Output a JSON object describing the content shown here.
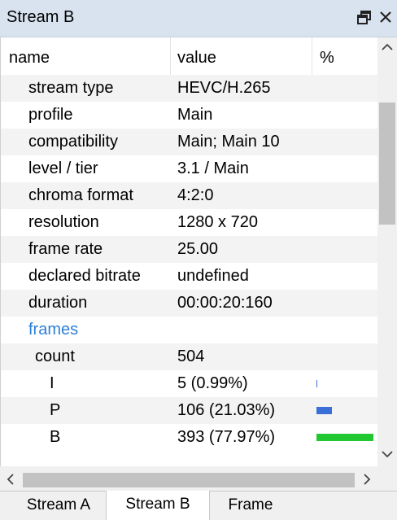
{
  "panel": {
    "title": "Stream B"
  },
  "table": {
    "headers": {
      "name": "name",
      "value": "value",
      "percent": "%"
    },
    "rows": [
      {
        "name": "stream type",
        "value": "HEVC/H.265",
        "level": 1
      },
      {
        "name": "profile",
        "value": "Main",
        "level": 1
      },
      {
        "name": "compatibility",
        "value": "Main; Main 10",
        "level": 1
      },
      {
        "name": "level / tier",
        "value": "3.1 / Main",
        "level": 1
      },
      {
        "name": "chroma format",
        "value": "4:2:0",
        "level": 1
      },
      {
        "name": "resolution",
        "value": "1280 x 720",
        "level": 1
      },
      {
        "name": "frame rate",
        "value": "25.00",
        "level": 1
      },
      {
        "name": "declared bitrate",
        "value": "undefined",
        "level": 1
      },
      {
        "name": "duration",
        "value": "00:00:20:160",
        "level": 1
      },
      {
        "name": "frames",
        "value": "",
        "level": 1,
        "link": true
      },
      {
        "name": "count",
        "value": "504",
        "level": 2
      },
      {
        "name": "I",
        "value": "5 (0.99%)",
        "level": 3,
        "bar_fraction": 0.0099,
        "bar_color": "#3a6fd8"
      },
      {
        "name": "P",
        "value": "106 (21.03%)",
        "level": 3,
        "bar_fraction": 0.2103,
        "bar_color": "#3a6fd8"
      },
      {
        "name": "B",
        "value": "393 (77.97%)",
        "level": 3,
        "bar_fraction": 0.7797,
        "bar_color": "#22c832"
      }
    ]
  },
  "tabs": [
    {
      "label": "Stream A",
      "active": false
    },
    {
      "label": "Stream B",
      "active": true
    },
    {
      "label": "Frame",
      "active": false
    }
  ],
  "colors": {
    "titlebar_bg": "#d9e3ef",
    "link": "#2e7fd8",
    "row_alt": "#f3f3f3"
  }
}
